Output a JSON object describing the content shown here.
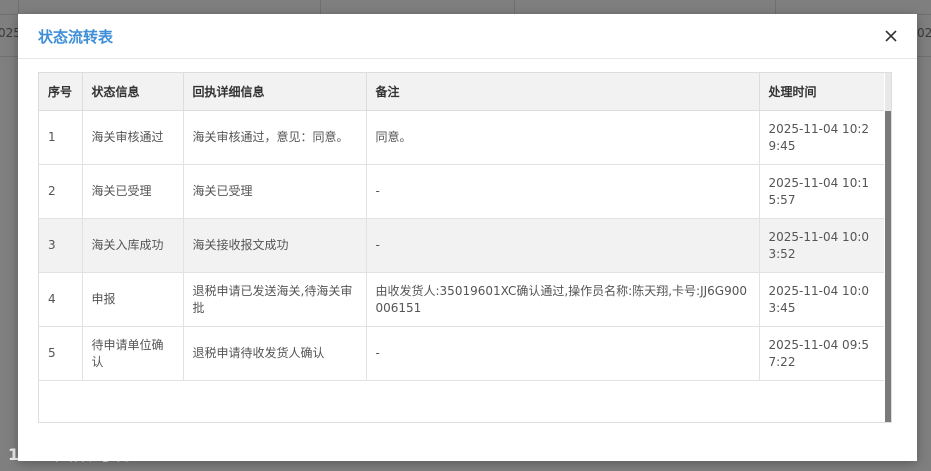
{
  "background": {
    "left_fragment": "025",
    "right_fragment": "02"
  },
  "watermark": {
    "logo": "1C°°",
    "text": "大数跨境"
  },
  "modal": {
    "title": "状态流转表",
    "close_icon": "close-icon",
    "title_color": "#3f8fd8"
  },
  "table": {
    "columns": [
      "序号",
      "状态信息",
      "回执详细信息",
      "备注",
      "处理时间"
    ],
    "rows": [
      {
        "index": "1",
        "status": "海关审核通过",
        "detail": "海关审核通过，意见：同意。",
        "remark": "同意。",
        "time": "2025-11-04 10:29:45"
      },
      {
        "index": "2",
        "status": "海关已受理",
        "detail": "海关已受理",
        "remark": "-",
        "time": "2025-11-04 10:15:57"
      },
      {
        "index": "3",
        "status": "海关入库成功",
        "detail": "海关接收报文成功",
        "remark": "-",
        "time": "2025-11-04 10:03:52"
      },
      {
        "index": "4",
        "status": "申报",
        "detail": "退税申请已发送海关,待海关审批",
        "remark": "由收发货人:35019601XC确认通过,操作员名称:陈天翔,卡号:JJ6G900006151",
        "time": "2025-11-04 10:03:45"
      },
      {
        "index": "5",
        "status": "待申请单位确认",
        "detail": "退税申请待收发货人确认",
        "remark": "-",
        "time": "2025-11-04 09:57:22"
      }
    ]
  }
}
